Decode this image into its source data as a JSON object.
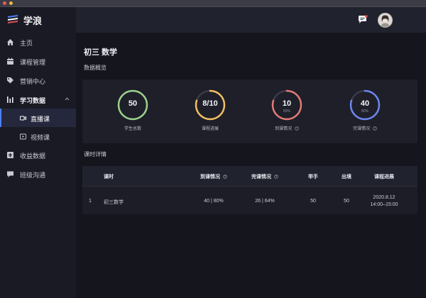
{
  "app": {
    "name": "学浪"
  },
  "window": {
    "controls": [
      "close",
      "minimize"
    ]
  },
  "sidebar": {
    "items": [
      {
        "label": "主页",
        "icon": "home-icon"
      },
      {
        "label": "课程管理",
        "icon": "calendar-icon"
      },
      {
        "label": "营销中心",
        "icon": "tag-icon"
      },
      {
        "label": "学习数据",
        "icon": "bar-chart-icon",
        "expanded": true,
        "children": [
          {
            "label": "直播课",
            "icon": "video-camera-icon",
            "active": true
          },
          {
            "label": "视频课",
            "icon": "video-file-icon"
          }
        ]
      },
      {
        "label": "收益数据",
        "icon": "finance-icon"
      },
      {
        "label": "班级沟通",
        "icon": "chat-icon"
      }
    ]
  },
  "topbar": {
    "message_icon": "message-icon",
    "avatar": "user-avatar"
  },
  "main": {
    "title": "初三 数学",
    "overview_label": "数据概览",
    "stats": [
      {
        "value": "50",
        "caption": "学生总数",
        "color": "#9bd18b",
        "progress": 1.0,
        "info": false,
        "pct": ""
      },
      {
        "value": "8/10",
        "caption": "课程进展",
        "color": "#f0c060",
        "progress": 0.8,
        "info": false,
        "pct": ""
      },
      {
        "value": "10",
        "caption": "到课情况",
        "color": "#e27a75",
        "progress": 0.8,
        "info": true,
        "pct": "80%"
      },
      {
        "value": "40",
        "caption": "完课情况",
        "color": "#6c86ef",
        "progress": 0.8,
        "info": true,
        "pct": "80%"
      }
    ],
    "detail_label": "课时详情",
    "table": {
      "headers": [
        "课时",
        "到课情况",
        "完课情况",
        "举手",
        "出境",
        "课程进展"
      ],
      "rows": [
        {
          "index": "1",
          "name": "初三数学",
          "attendance": "40 | 80%",
          "completion": "26 | 64%",
          "raise_hand": "50",
          "on_camera": "50",
          "progress_date": "2020.8.12",
          "progress_time": "14:00–15:00"
        }
      ]
    }
  }
}
